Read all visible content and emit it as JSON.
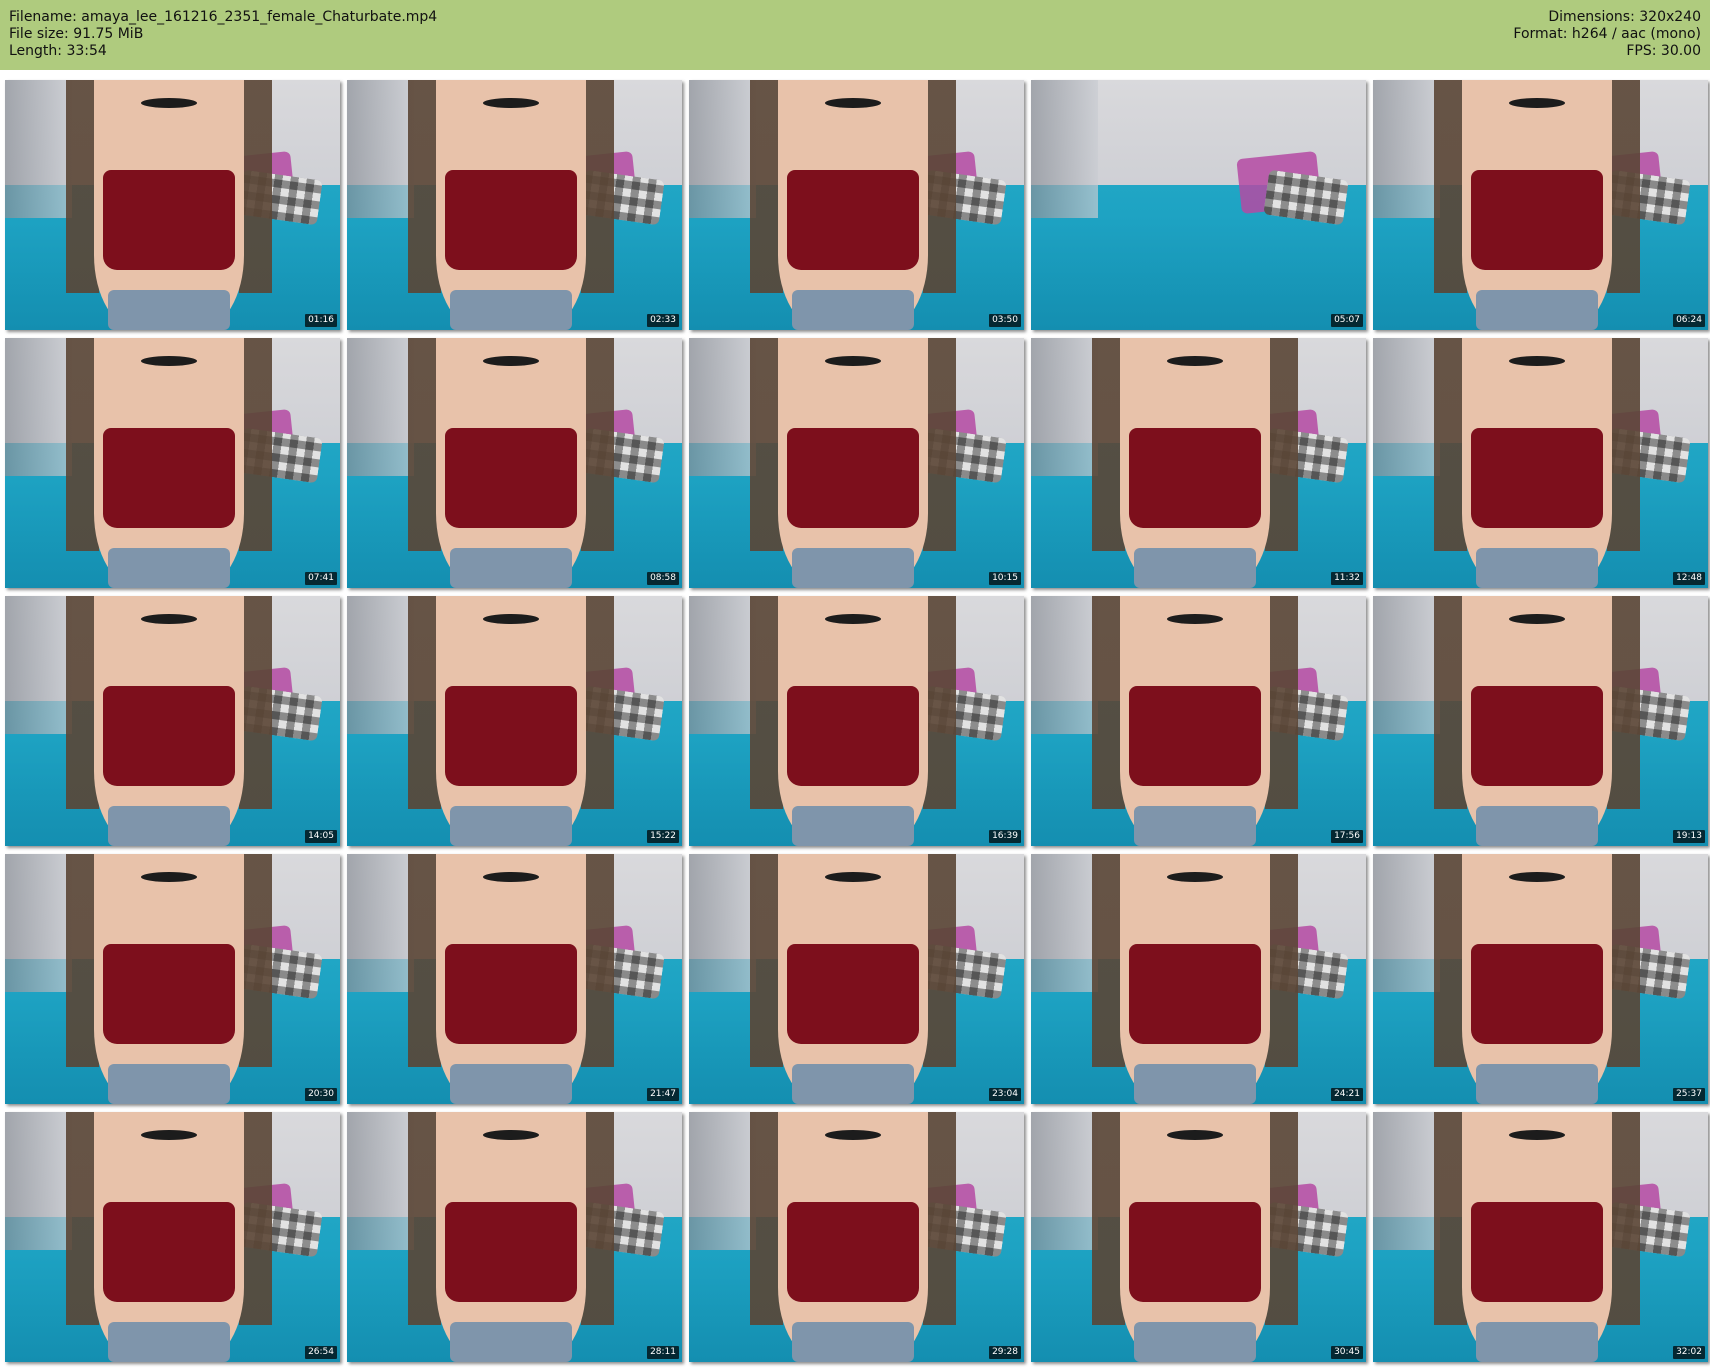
{
  "header": {
    "filename": "Filename: amaya_lee_161216_2351_female_Chaturbate.mp4",
    "filesize": "File size: 91.75 MiB",
    "length": "Length: 33:54",
    "dimensions": "Dimensions: 320x240",
    "format": "Format: h264 / aac (mono)",
    "fps": "FPS: 30.00"
  },
  "thumbnails": [
    {
      "time": "01:16"
    },
    {
      "time": "02:33"
    },
    {
      "time": "03:50"
    },
    {
      "time": "05:07"
    },
    {
      "time": "06:24"
    },
    {
      "time": "07:41"
    },
    {
      "time": "08:58"
    },
    {
      "time": "10:15"
    },
    {
      "time": "11:32"
    },
    {
      "time": "12:48"
    },
    {
      "time": "14:05"
    },
    {
      "time": "15:22"
    },
    {
      "time": "16:39"
    },
    {
      "time": "17:56"
    },
    {
      "time": "19:13"
    },
    {
      "time": "20:30"
    },
    {
      "time": "21:47"
    },
    {
      "time": "23:04"
    },
    {
      "time": "24:21"
    },
    {
      "time": "25:37"
    },
    {
      "time": "26:54"
    },
    {
      "time": "28:11"
    },
    {
      "time": "29:28"
    },
    {
      "time": "30:45"
    },
    {
      "time": "32:02"
    }
  ],
  "colors": {
    "header_bg": "#afcb7e",
    "bed": "#20a6c5",
    "top": "#7d0f1c"
  }
}
